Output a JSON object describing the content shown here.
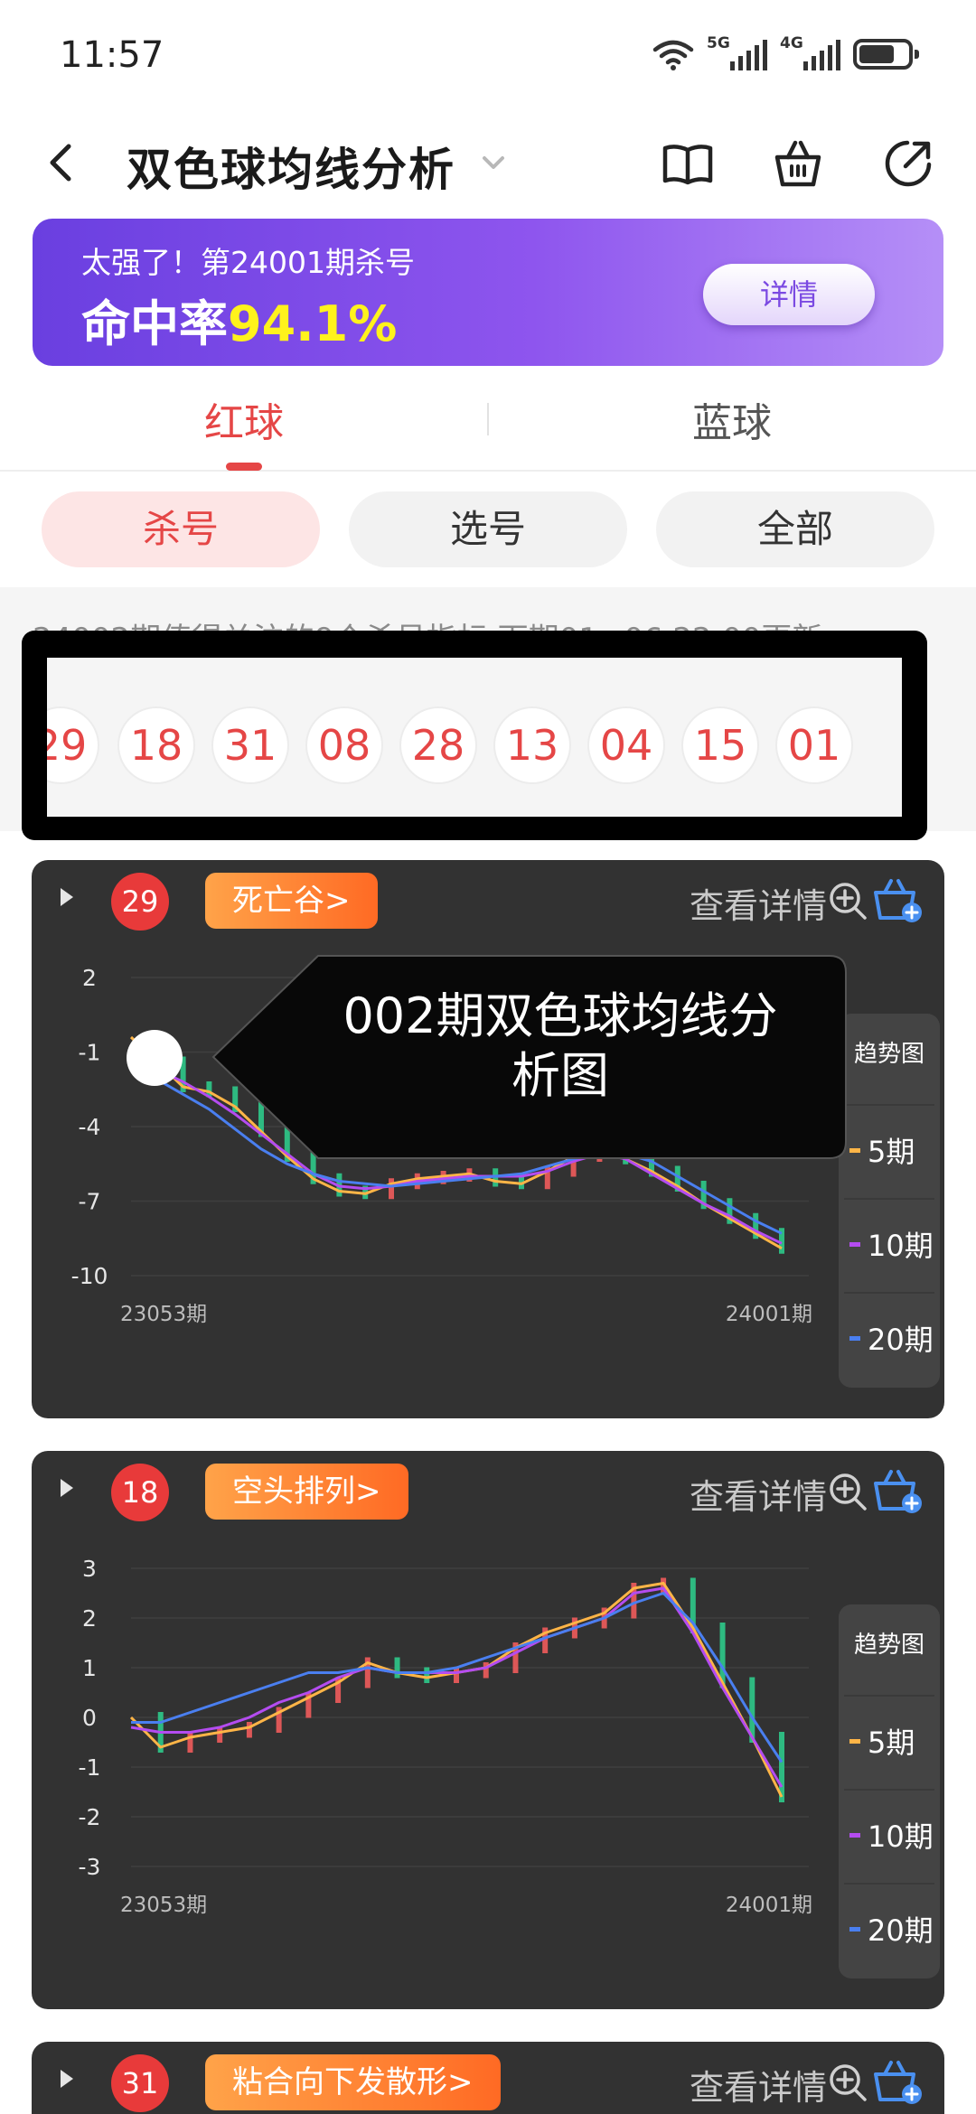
{
  "status_bar": {
    "time": "11:57",
    "net1": "5G",
    "net2": "4G"
  },
  "header": {
    "title": "双色球均线分析"
  },
  "banner": {
    "subtitle": "太强了！第24001期杀号",
    "rate_label": "命中率",
    "rate_value": "94.1%",
    "detail_button": "详情",
    "accent_color": "#fff21c"
  },
  "ball_tabs": {
    "red": "红球",
    "blue": "蓝球"
  },
  "filters": {
    "kill": "杀号",
    "select": "选号",
    "all": "全部"
  },
  "info_text": "24002期值得关注的9个杀号指标,下期01~06 22:00更新",
  "kill_numbers": [
    "29",
    "18",
    "31",
    "08",
    "28",
    "13",
    "04",
    "15",
    "01"
  ],
  "tooltip_text": "002期双色球均线分析图",
  "cards": [
    {
      "number": "29",
      "tag": "死亡谷>",
      "detail": "查看详情",
      "legend_title": "趋势图",
      "legend": [
        {
          "label": "5期",
          "color": "#ffb547"
        },
        {
          "label": "10期",
          "color": "#b44cf0"
        },
        {
          "label": "20期",
          "color": "#4a7ff0"
        }
      ],
      "chart_data": {
        "type": "line",
        "x_start": "23053期",
        "x_end": "24001期",
        "yticks": [
          "2",
          "-1",
          "-4",
          "-7",
          "-10"
        ],
        "ylim": [
          -10,
          2
        ],
        "series": [
          {
            "name": "5期",
            "values": [
              -0.4,
              -1.4,
              -2.4,
              -2.6,
              -3.2,
              -4.2,
              -5.2,
              -6.1,
              -6.6,
              -6.7,
              -6.3,
              -6.1,
              -6.0,
              -5.9,
              -6.2,
              -6.3,
              -5.8,
              -5.2,
              -5.0,
              -5.3,
              -5.8,
              -6.4,
              -7.1,
              -7.7,
              -8.3,
              -8.9
            ]
          },
          {
            "name": "10期",
            "values": [
              -1.0,
              -1.7,
              -2.2,
              -2.8,
              -3.5,
              -4.3,
              -5.1,
              -5.9,
              -6.4,
              -6.5,
              -6.4,
              -6.2,
              -6.1,
              -6.0,
              -6.0,
              -6.0,
              -5.8,
              -5.4,
              -5.1,
              -5.3,
              -5.9,
              -6.5,
              -7.1,
              -7.6,
              -8.2,
              -8.7
            ]
          },
          {
            "name": "20期",
            "values": [
              -1.6,
              -2.1,
              -2.7,
              -3.3,
              -4.1,
              -4.9,
              -5.5,
              -5.9,
              -6.2,
              -6.3,
              -6.4,
              -6.3,
              -6.2,
              -6.1,
              -6.0,
              -5.9,
              -5.6,
              -5.3,
              -5.1,
              -5.1,
              -5.4,
              -6.0,
              -6.6,
              -7.2,
              -7.8,
              -8.3
            ]
          }
        ]
      }
    },
    {
      "number": "18",
      "tag": "空头排列>",
      "detail": "查看详情",
      "legend_title": "趋势图",
      "legend": [
        {
          "label": "5期",
          "color": "#ffb547"
        },
        {
          "label": "10期",
          "color": "#b44cf0"
        },
        {
          "label": "20期",
          "color": "#4a7ff0"
        }
      ],
      "chart_data": {
        "type": "line",
        "x_start": "23053期",
        "x_end": "24001期",
        "yticks": [
          "3",
          "2",
          "1",
          "0",
          "-1",
          "-2",
          "-3"
        ],
        "ylim": [
          -3,
          3
        ],
        "series": [
          {
            "name": "5期",
            "values": [
              0.0,
              -0.6,
              -0.4,
              -0.3,
              -0.2,
              0.1,
              0.4,
              0.7,
              1.1,
              0.9,
              0.8,
              0.9,
              1.0,
              1.4,
              1.7,
              1.9,
              2.1,
              2.6,
              2.7,
              1.8,
              0.7,
              -0.4,
              -1.6
            ]
          },
          {
            "name": "10期",
            "values": [
              -0.2,
              -0.3,
              -0.3,
              -0.2,
              0.0,
              0.3,
              0.5,
              0.8,
              1.0,
              0.9,
              0.9,
              0.9,
              1.0,
              1.3,
              1.6,
              1.8,
              2.0,
              2.5,
              2.6,
              1.7,
              0.6,
              -0.4,
              -1.4
            ]
          },
          {
            "name": "20期",
            "values": [
              -0.1,
              -0.1,
              0.1,
              0.3,
              0.5,
              0.7,
              0.9,
              0.9,
              1.0,
              0.9,
              0.9,
              1.0,
              1.2,
              1.4,
              1.6,
              1.8,
              2.0,
              2.3,
              2.5,
              1.9,
              1.0,
              0.0,
              -0.9
            ]
          }
        ]
      }
    },
    {
      "number": "31",
      "tag": "粘合向下发散形>",
      "detail": "查看详情"
    }
  ]
}
